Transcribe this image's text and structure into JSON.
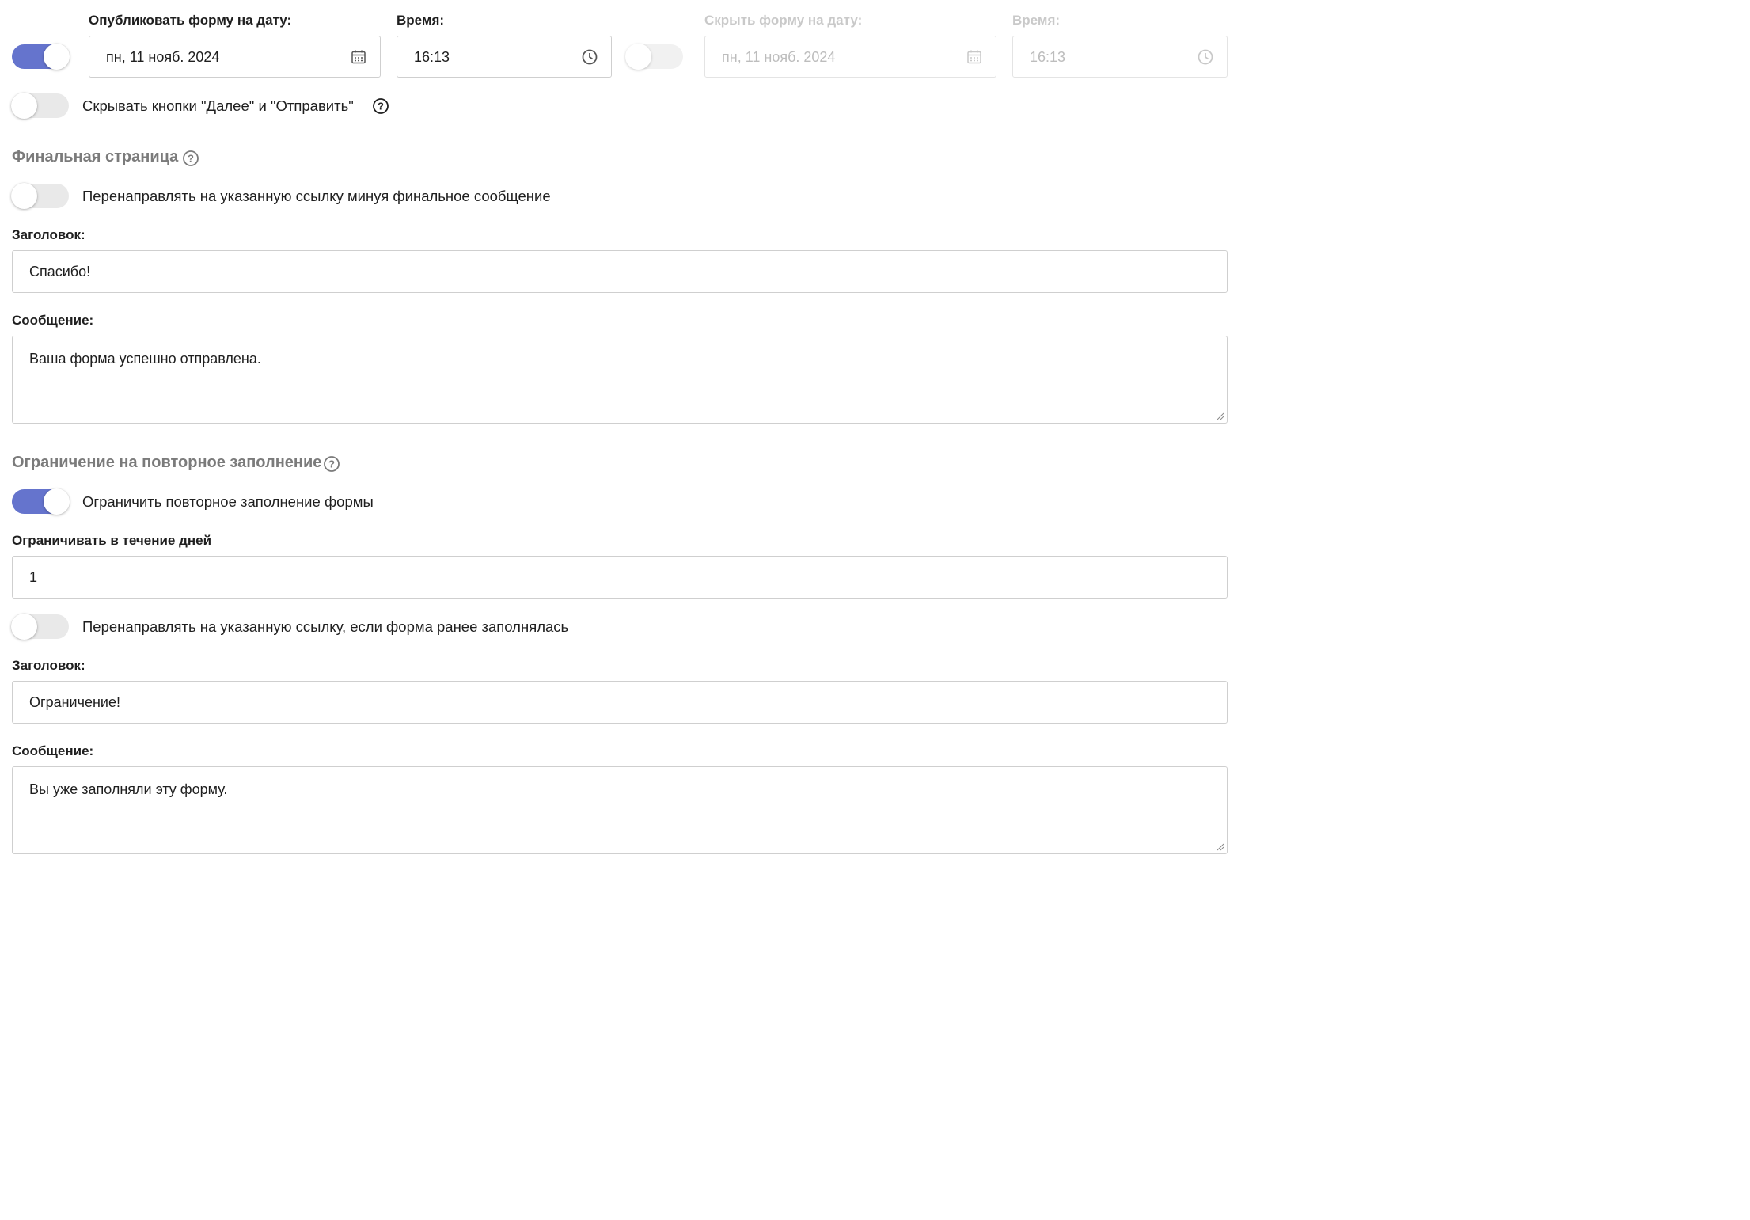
{
  "publish": {
    "date_label": "Опубликовать форму на дату:",
    "date_value": "пн, 11 нояб. 2024",
    "time_label": "Время:",
    "time_value": "16:13",
    "enabled": true
  },
  "hide": {
    "date_label": "Скрыть форму на дату:",
    "date_value": "пн, 11 нояб. 2024",
    "time_label": "Время:",
    "time_value": "16:13",
    "enabled": false
  },
  "hide_buttons": {
    "label": "Скрывать кнопки \"Далее\" и \"Отправить\"",
    "enabled": false
  },
  "final_page": {
    "title": "Финальная страница",
    "redirect_label": "Перенаправлять на указанную ссылку минуя финальное сообщение",
    "redirect_enabled": false,
    "heading_label": "Заголовок:",
    "heading_value": "Спасибо!",
    "message_label": "Сообщение:",
    "message_value": "Ваша форма успешно отправлена."
  },
  "repeat_limit": {
    "title": "Ограничение на повторное заполнение",
    "limit_label": "Ограничить повторное заполнение формы",
    "limit_enabled": true,
    "days_label": "Ограничивать в течение дней",
    "days_value": "1",
    "redirect_label": "Перенаправлять на указанную ссылку, если форма ранее заполнялась",
    "redirect_enabled": false,
    "heading_label": "Заголовок:",
    "heading_value": "Ограничение!",
    "message_label": "Сообщение:",
    "message_value": "Вы уже заполняли эту форму."
  },
  "icons": {
    "calendar": "calendar-icon",
    "clock": "clock-icon",
    "help": "question-circle-icon"
  },
  "colors": {
    "accent": "#6574cd",
    "section_title": "#7b7b7b",
    "disabled_text": "#bdbdbd"
  }
}
